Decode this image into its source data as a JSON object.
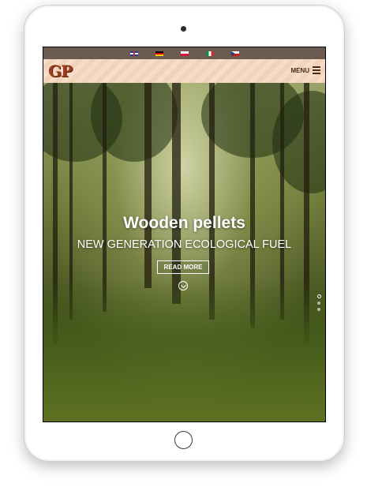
{
  "languages": [
    {
      "code": "en",
      "icon": "uk-flag-icon"
    },
    {
      "code": "de",
      "icon": "german-flag-icon"
    },
    {
      "code": "pl",
      "icon": "polish-flag-icon"
    },
    {
      "code": "it",
      "icon": "italian-flag-icon"
    },
    {
      "code": "cz",
      "icon": "czech-flag-icon"
    }
  ],
  "header": {
    "logo_text": "GP",
    "menu_label": "MENU",
    "menu_icon": "hamburger-icon"
  },
  "hero": {
    "title": "Wooden pellets",
    "subtitle": "NEW GENERATION ECOLOGICAL FUEL",
    "button_label": "READ MORE",
    "scroll_icon": "chevron-down-circle-icon",
    "slide_count": 3,
    "active_slide": 1
  },
  "colors": {
    "langbar": "#6a5a50",
    "header_bg": "#f7dcc7",
    "logo": "#9e3d1d",
    "menu_text": "#4a2a1a"
  }
}
